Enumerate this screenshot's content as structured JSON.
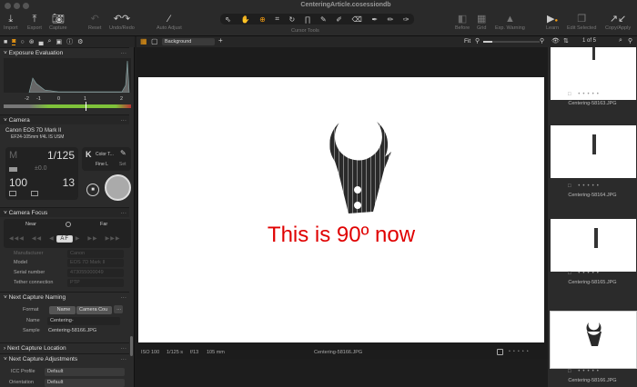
{
  "window": {
    "title": "CenteringArticle.cosessiondb"
  },
  "toolbar": {
    "import": "Import",
    "export": "Export",
    "capture": "Capture",
    "reset": "Reset",
    "undo_redo": "Undo/Redo",
    "auto_adjust": "Auto Adjust",
    "cursor_tools": "Cursor Tools",
    "before": "Before",
    "grid": "Grid",
    "exp_warning": "Exp. Warning",
    "learn": "Learn",
    "edit_selected": "Edit Selected",
    "copy_apply": "Copy/Apply",
    "accent": "#f39c12"
  },
  "viewer": {
    "background_select": "Background",
    "zoom_label": "Fit",
    "caption": "This is 90º now",
    "caption_color": "#e00000"
  },
  "exposure": {
    "title": "Exposure Evaluation",
    "scale": [
      "-2",
      "-1",
      "0",
      "1",
      "2"
    ]
  },
  "camera": {
    "title": "Camera",
    "model": "Canon EOS 7D Mark II",
    "lens": "EF24-105mm f/4L IS USM",
    "mode": "M",
    "shutter": "1/125",
    "ev": "±0.0",
    "iso": "100",
    "aperture": "13",
    "wb": "Color T...",
    "format": "Fine L",
    "set": "Set"
  },
  "focus": {
    "title": "Camera Focus",
    "near": "Near",
    "far": "Far",
    "af": "AF"
  },
  "metadata": {
    "rows": [
      {
        "label": "Manufacturer",
        "value": "Canon"
      },
      {
        "label": "Model",
        "value": "EOS 7D Mark II"
      },
      {
        "label": "Serial number",
        "value": "473055000049"
      },
      {
        "label": "Tether connection",
        "value": "PTP"
      }
    ]
  },
  "naming": {
    "title": "Next Capture Naming",
    "format_label": "Format",
    "token1": "Name",
    "token2": "Camera Cou",
    "name_label": "Name",
    "name_value": "Centering-",
    "sample_label": "Sample",
    "sample_value": "Centering-58166.JPG"
  },
  "location": {
    "title": "Next Capture Location"
  },
  "adjustments": {
    "title": "Next Capture Adjustments",
    "icc_label": "ICC Profile",
    "icc_value": "Default",
    "orientation_label": "Orientation",
    "orientation_value": "Default"
  },
  "status": {
    "iso": "ISO 100",
    "shutter": "1/125 s",
    "aperture": "f/13",
    "focal": "105 mm",
    "filename": "Centering-58166.JPG"
  },
  "browser": {
    "count": "1 of 5",
    "items": [
      {
        "name": "Centering-58163.JPG"
      },
      {
        "name": "Centering-58164.JPG"
      },
      {
        "name": "Centering-58165.JPG"
      },
      {
        "name": "Centering-58166.JPG",
        "selected": true
      }
    ]
  }
}
